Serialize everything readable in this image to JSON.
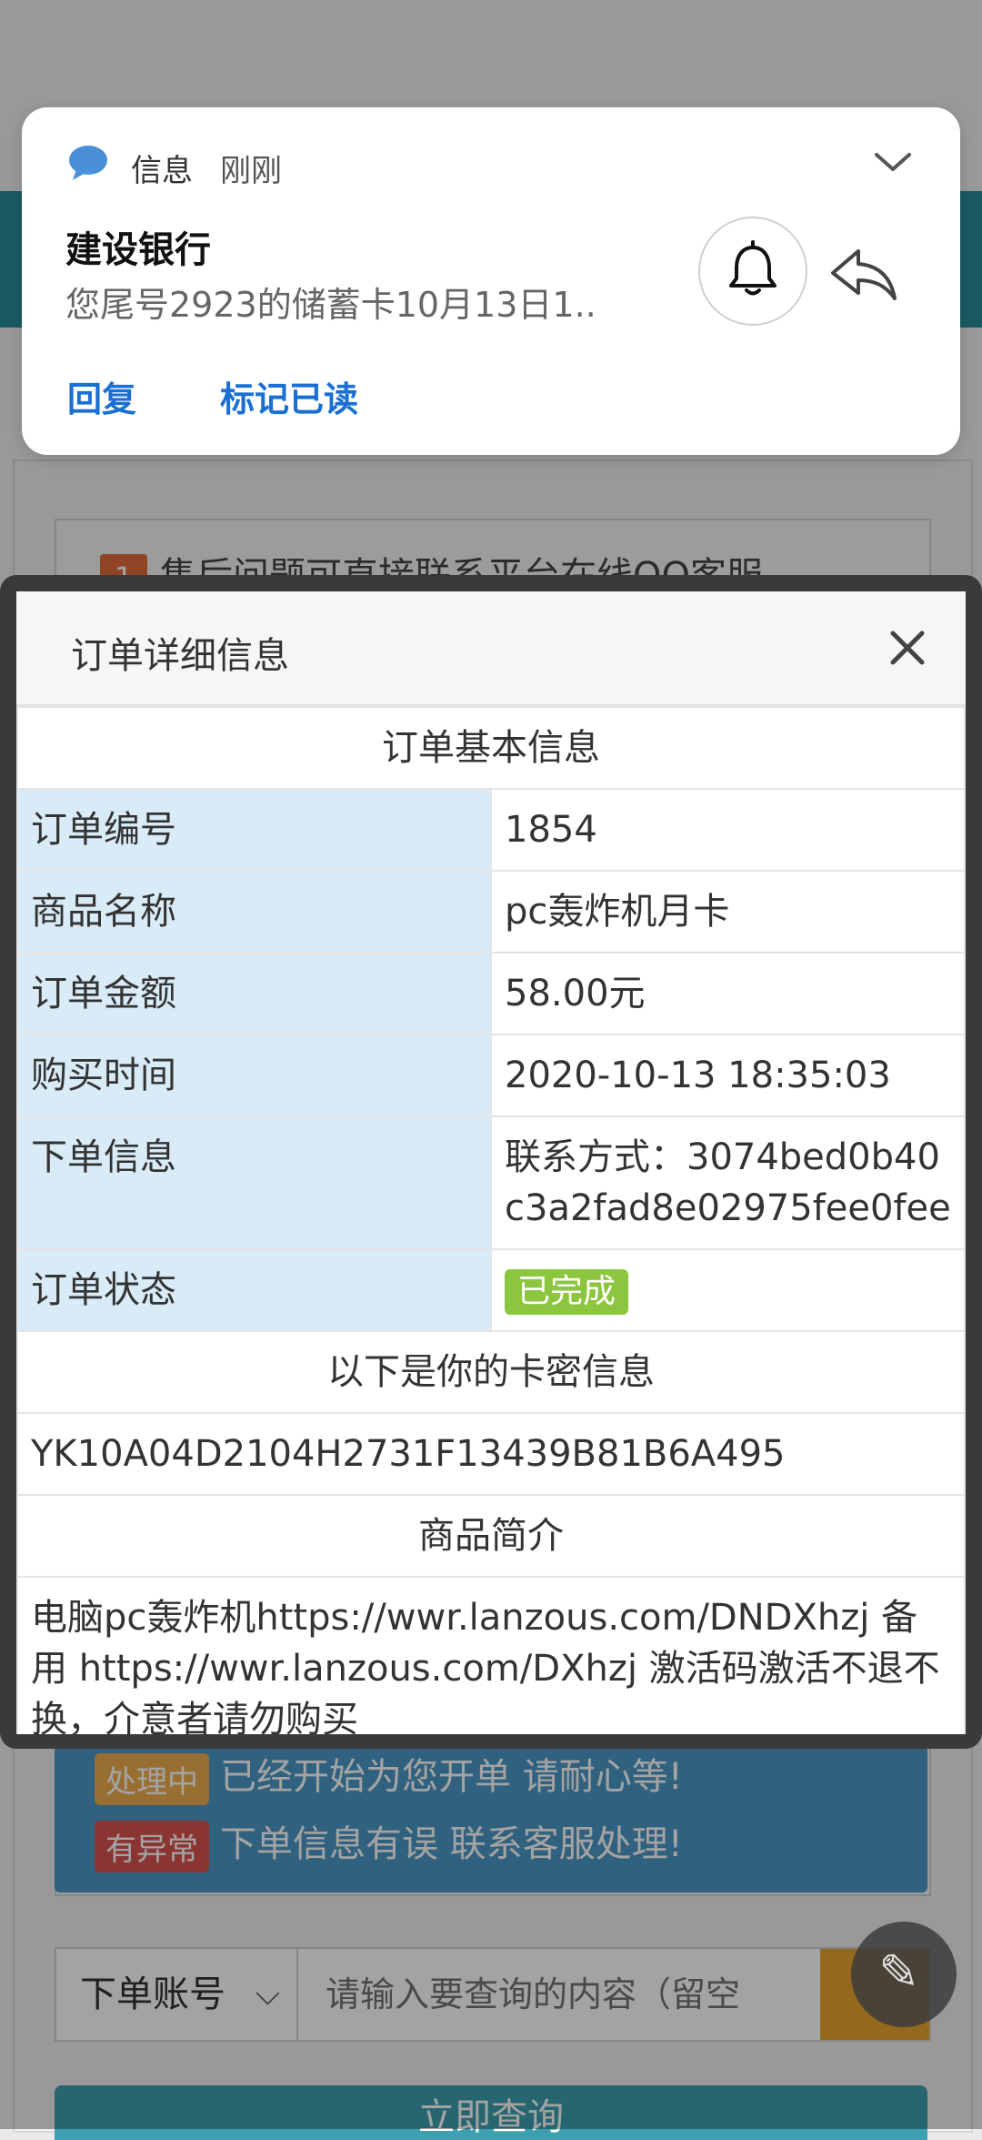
{
  "notification": {
    "app_name": "信息",
    "time": "刚刚",
    "title": "建设银行",
    "body": "您尾号2923的储蓄卡10月13日1..",
    "actions": [
      "回复",
      "标记已读"
    ],
    "icons": [
      "message-bubble-icon",
      "chevron-down-icon",
      "bell-icon",
      "reply-arrow-icon"
    ]
  },
  "background_page": {
    "notice_number": "1",
    "notice_text": "售后问题可直接联系平台在线QQ客服",
    "status_rows": [
      {
        "tag": "处理中",
        "text": "已经开始为您开单 请耐心等!"
      },
      {
        "tag": "有异常",
        "text": "下单信息有误 联系客服处理!"
      }
    ],
    "search": {
      "select_value": "下单账号",
      "input_placeholder": "请输入要查询的内容（留空"
    },
    "query_button": "立即查询"
  },
  "modal": {
    "title": "订单详细信息",
    "section_basic": "订单基本信息",
    "rows": [
      {
        "label": "订单编号",
        "value": "1854"
      },
      {
        "label": "商品名称",
        "value": "pc轰炸机月卡"
      },
      {
        "label": "订单金额",
        "value": "58.00元"
      },
      {
        "label": "购买时间",
        "value": "2020-10-13 18:35:03"
      },
      {
        "label": "下单信息",
        "value": "联系方式：3074bed0b40c3a2fad8e02975fee0fee"
      },
      {
        "label": "订单状态",
        "value": "已完成"
      }
    ],
    "section_card": "以下是你的卡密信息",
    "card_key": "YK10A04D2104H2731F13439B81B6A495",
    "section_intro": "商品简介",
    "intro_text": "电脑pc轰炸机https://wwr.lanzous.com/DNDXhzj 备用 https://wwr.lanzous.com/DXhzj 激活码激活不退不换，介意者请勿购买"
  },
  "colors": {
    "teal": "#2a8f9c",
    "status_blue": "#4b98c7",
    "label_bg": "#d9ebf7",
    "done_green": "#8cc63f",
    "link_blue": "#1a6fd4"
  }
}
